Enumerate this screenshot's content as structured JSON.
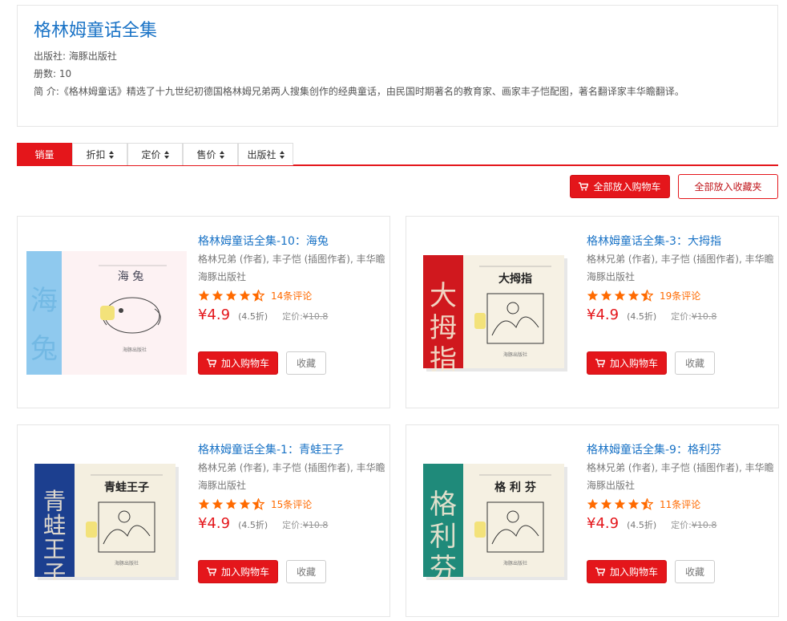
{
  "series": {
    "title": "格林姆童话全集",
    "publisher_line": "出版社: 海豚出版社",
    "volumes_line": "册数: 10",
    "intro": "简 介:《格林姆童话》精选了十九世纪初德国格林姆兄弟两人搜集创作的经典童话，由民国时期著名的教育家、画家丰子恺配图，著名翻译家丰华瞻翻译。"
  },
  "sort_tabs": [
    {
      "label": "销量",
      "active": true
    },
    {
      "label": "折扣",
      "active": false
    },
    {
      "label": "定价",
      "active": false
    },
    {
      "label": "售价",
      "active": false
    },
    {
      "label": "出版社",
      "active": false
    }
  ],
  "bulk_actions": {
    "add_all_cart": "全部放入购物车",
    "add_all_fav": "全部放入收藏夹"
  },
  "icons": {
    "cart": "cart-icon",
    "star": "star-icon",
    "sort": "sort-icon"
  },
  "colors": {
    "accent_red": "#e4161b",
    "link_blue": "#1a73c6",
    "review_orange": "#ff6a00"
  },
  "books": [
    {
      "title": "格林姆童话全集-10：海兔",
      "authors": "格林兄弟 (作者), 丰子恺 (插图作者), 丰华瞻",
      "publisher": "海豚出版社",
      "rating": 4.5,
      "reviews": "14条评论",
      "price": "¥4.9",
      "discount": "(4.5折)",
      "orig_label": "定价:",
      "orig_price": "¥10.8",
      "cart_label": "加入购物车",
      "fav_label": "收藏",
      "cover": {
        "spine_text": "海兔",
        "cover_title": "海 兔",
        "spine_color": "#8fc9ee",
        "bg_color": "#fdf2f3"
      }
    },
    {
      "title": "格林姆童话全集-3：大拇指",
      "authors": "格林兄弟 (作者), 丰子恺 (插图作者), 丰华瞻",
      "publisher": "海豚出版社",
      "rating": 4.5,
      "reviews": "19条评论",
      "price": "¥4.9",
      "discount": "(4.5折)",
      "orig_label": "定价:",
      "orig_price": "¥10.8",
      "cart_label": "加入购物车",
      "fav_label": "收藏",
      "cover": {
        "spine_text": "大拇指",
        "cover_title": "大拇指",
        "spine_color": "#d0181e",
        "bg_color": "#f6f1e4"
      }
    },
    {
      "title": "格林姆童话全集-1：青蛙王子",
      "authors": "格林兄弟 (作者), 丰子恺 (插图作者), 丰华瞻",
      "publisher": "海豚出版社",
      "rating": 4.5,
      "reviews": "15条评论",
      "price": "¥4.9",
      "discount": "(4.5折)",
      "orig_label": "定价:",
      "orig_price": "¥10.8",
      "cart_label": "加入购物车",
      "fav_label": "收藏",
      "cover": {
        "spine_text": "青蛙王子",
        "cover_title": "青蛙王子",
        "spine_color": "#1c3f8f",
        "bg_color": "#f4efe0"
      }
    },
    {
      "title": "格林姆童话全集-9：格利芬",
      "authors": "格林兄弟 (作者), 丰子恺 (插图作者), 丰华瞻",
      "publisher": "海豚出版社",
      "rating": 4.5,
      "reviews": "11条评论",
      "price": "¥4.9",
      "discount": "(4.5折)",
      "orig_label": "定价:",
      "orig_price": "¥10.8",
      "cart_label": "加入购物车",
      "fav_label": "收藏",
      "cover": {
        "spine_text": "格利芬",
        "cover_title": "格 利 芬",
        "spine_color": "#1f8a7a",
        "bg_color": "#f5f0e2"
      }
    }
  ]
}
